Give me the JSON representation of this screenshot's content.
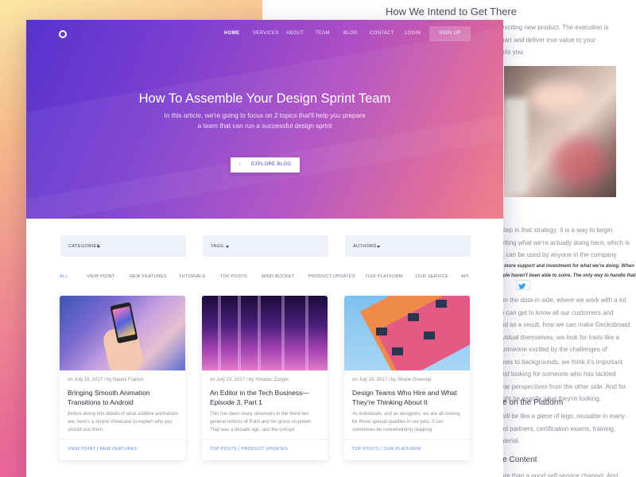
{
  "background_doc": {
    "heading": "How We Intend to Get There",
    "para1": [
      "exciting new product. The execution is",
      "part and deliver true value to your",
      "hits you."
    ],
    "para2": [
      "step in that strategy: it is a way to begin",
      "etting what we're actually doing here, which is",
      "it can be used by anyone in the company."
    ],
    "quote": [
      "re's more support and investment for what we're doing. When",
      "people haven't been able to solve. The only way to handle that",
      "n.\""
    ],
    "para3": [
      "on the data-in side, where we work with a lot",
      "o can get to know all our customers and",
      "nd as a result, how we can make Geckoboard",
      "ividual themselves, we look for traits like a",
      "someone excited by the challenges of",
      "mes to backgrounds, we think it's important",
      "ust looking for someone who has tackled",
      "ear perspectives from the other side. And for",
      "ight be exactly what they're looking."
    ],
    "sub1": "le on the Platform",
    "para4": [
      "will be like a piece of lego, reusable in many",
      "nd partners, certification exams, training,",
      "aterial."
    ],
    "sub2": "le Content",
    "para5": [
      "ore than a good self-service channel. And"
    ]
  },
  "nav": {
    "items": [
      "HOME",
      "SERVICES",
      "ABOUT",
      "TEAM",
      "BLOG",
      "CONTACT",
      "LOGIN"
    ],
    "signup": "SIGN UP"
  },
  "hero": {
    "title": "How To Assemble Your Design Sprint Team",
    "subtitle": "In this article, we're going to focus on 2 topics that'll help you prepare a team that can run a successful design sprint",
    "cta": "EXPLORE BLOG"
  },
  "filters": {
    "categories": "CATEGORIES",
    "tags": "TAGS",
    "authors": "AUTHORS"
  },
  "tabs": [
    "ALL",
    "VIEW POINT",
    "NEW FEATURES",
    "TUTORIALS",
    "TOP POSTS",
    "MIND BUCKET",
    "PRODUCT UPDATES",
    "OUR PLATFORM",
    "OUR SERVICE",
    "API"
  ],
  "articles": [
    {
      "meta": "on July 19, 2017 / by Naomi Francis",
      "title": "Bringing Smooth Animation Transitions to Android",
      "excerpt": "Before diving into details of what additive animations are, here's a simple showcase to explain why you should use them.",
      "tags": "VIEW POINT | NEW FEATURES"
    },
    {
      "meta": "on July 23, 2017 / by Yonatan Zunger",
      "title": "An Editor in the Tech Business— Episode 3, Part 1",
      "excerpt": "This has been many observers in the West two general notions of Putin and his grasp on power. That was a decade ago, and the corrupt.",
      "tags": "TOP POSTS | PRODUCT UPDATES"
    },
    {
      "meta": "on July 24, 2017 / by Shane Greenup",
      "title": "Design Teams Who Hire and What They're Thinking About It",
      "excerpt": "As individuals, and as designers, we are all looking for those special qualities in our jobs. It can sometimes be overwhelming stepping.",
      "tags": "TOP POSTS | OUR PLATFORM"
    }
  ]
}
